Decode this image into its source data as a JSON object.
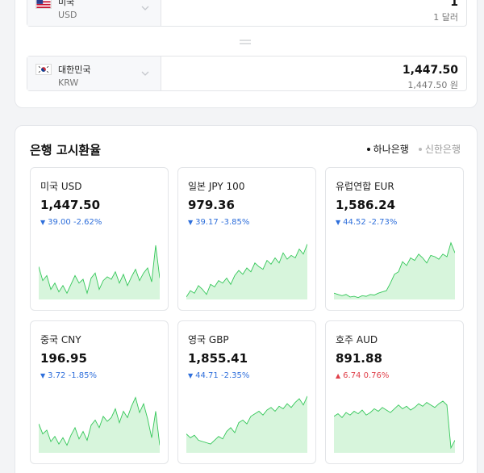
{
  "converter": {
    "from": {
      "country": "미국",
      "code": "USD",
      "amount": "1",
      "amount_text": "1 달러"
    },
    "to": {
      "country": "대한민국",
      "code": "KRW",
      "amount": "1,447.50",
      "amount_text": "1,447.50 원"
    }
  },
  "bank": {
    "title": "은행 고시환율",
    "tabs": [
      {
        "label": "하나은행",
        "active": true
      },
      {
        "label": "신한은행",
        "active": false
      }
    ],
    "cards": [
      {
        "name": "미국 USD",
        "rate": "1,447.50",
        "direction": "down",
        "change": "39.00",
        "pct": "-2.62%",
        "spark": [
          0.52,
          0.3,
          0.38,
          0.16,
          0.26,
          0.12,
          0.22,
          0.1,
          0.24,
          0.38,
          0.26,
          0.32,
          0.1,
          0.34,
          0.42,
          0.16,
          0.3,
          0.36,
          0.32,
          0.44,
          0.26,
          0.4,
          0.22,
          0.36,
          0.48,
          0.3,
          0.42,
          0.5,
          0.28,
          0.86,
          0.34
        ]
      },
      {
        "name": "일본 JPY 100",
        "rate": "979.36",
        "direction": "down",
        "change": "39.17",
        "pct": "-3.85%",
        "spark": [
          0.04,
          0.14,
          0.1,
          0.22,
          0.16,
          0.08,
          0.24,
          0.2,
          0.3,
          0.26,
          0.34,
          0.24,
          0.38,
          0.46,
          0.4,
          0.5,
          0.44,
          0.58,
          0.52,
          0.48,
          0.62,
          0.56,
          0.66,
          0.58,
          0.74,
          0.64,
          0.7,
          0.66,
          0.8,
          0.72,
          0.88
        ]
      },
      {
        "name": "유럽연합 EUR",
        "rate": "1,586.24",
        "direction": "down",
        "change": "44.52",
        "pct": "-2.73%",
        "spark": [
          0.1,
          0.08,
          0.06,
          0.08,
          0.04,
          0.05,
          0.03,
          0.06,
          0.05,
          0.08,
          0.07,
          0.1,
          0.12,
          0.14,
          0.26,
          0.4,
          0.44,
          0.6,
          0.54,
          0.66,
          0.62,
          0.72,
          0.66,
          0.58,
          0.7,
          0.68,
          0.64,
          0.72,
          0.68,
          0.9,
          0.74
        ]
      },
      {
        "name": "중국 CNY",
        "rate": "196.95",
        "direction": "down",
        "change": "3.72",
        "pct": "-1.85%",
        "spark": [
          0.46,
          0.3,
          0.36,
          0.18,
          0.26,
          0.14,
          0.24,
          0.12,
          0.28,
          0.4,
          0.22,
          0.34,
          0.2,
          0.44,
          0.52,
          0.4,
          0.58,
          0.5,
          0.56,
          0.7,
          0.48,
          0.66,
          0.56,
          0.74,
          0.88,
          0.64,
          0.78,
          0.54,
          0.24,
          0.66,
          0.12
        ]
      },
      {
        "name": "영국 GBP",
        "rate": "1,855.41",
        "direction": "down",
        "change": "44.71",
        "pct": "-2.35%",
        "spark": [
          0.3,
          0.24,
          0.28,
          0.2,
          0.18,
          0.16,
          0.14,
          0.2,
          0.26,
          0.22,
          0.34,
          0.4,
          0.32,
          0.48,
          0.52,
          0.46,
          0.58,
          0.62,
          0.66,
          0.6,
          0.68,
          0.72,
          0.66,
          0.74,
          0.7,
          0.78,
          0.72,
          0.8,
          0.86,
          0.76,
          0.9
        ]
      },
      {
        "name": "호주 AUD",
        "rate": "891.88",
        "direction": "up",
        "change": "6.74",
        "pct": "0.76%",
        "spark": [
          0.58,
          0.62,
          0.56,
          0.64,
          0.6,
          0.66,
          0.62,
          0.68,
          0.6,
          0.64,
          0.7,
          0.66,
          0.72,
          0.68,
          0.64,
          0.7,
          0.76,
          0.7,
          0.74,
          0.68,
          0.72,
          0.78,
          0.74,
          0.8,
          0.76,
          0.72,
          0.78,
          0.82,
          0.76,
          0.08,
          0.2
        ]
      }
    ]
  },
  "colors": {
    "up": "#e0404a",
    "down": "#2f6fdb",
    "spark_line": "#34c759",
    "spark_fill": "#d7f5dc"
  }
}
